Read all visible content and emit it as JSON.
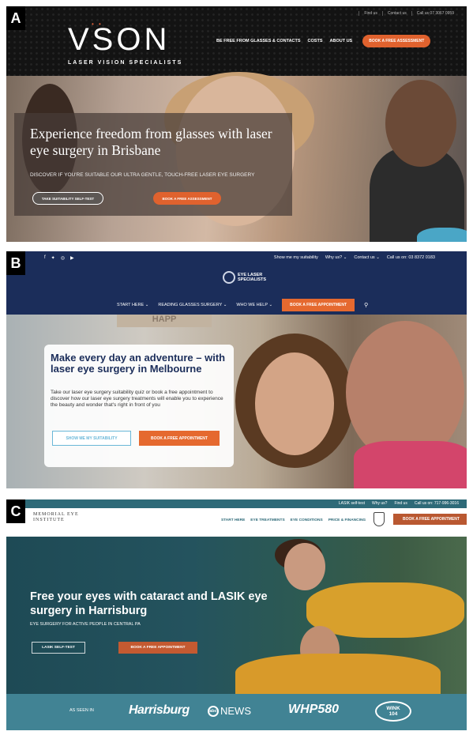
{
  "panel_a": {
    "letter": "A",
    "util_links": [
      "Find us",
      "Contact us",
      "Call us 07 3067 0959"
    ],
    "logo_word": "VSON",
    "logo_dots": "• •",
    "logo_sub": "LASER VISION SPECIALISTS",
    "nav": [
      "BE FREE FROM GLASSES & CONTACTS",
      "COSTS",
      "ABOUT US"
    ],
    "nav_cta": "BOOK A FREE ASSESSMENT",
    "headline": "Experience freedom from glasses with laser eye surgery in Brisbane",
    "subline": "DISCOVER IF YOU'RE SUITABLE OUR ULTRA GENTLE, TOUCH-FREE LASER EYE SURGERY",
    "button_primary": "TAKE SUITABILITY SELF-TEST",
    "button_secondary": "BOOK A FREE ASSESSMENT"
  },
  "panel_b": {
    "letter": "B",
    "social": [
      "f",
      "✦",
      "◎",
      "▶"
    ],
    "util_links": [
      "Show me my suitability",
      "Why us? ⌄",
      "Contact us ⌄",
      "Call us on: 03 8372 0183"
    ],
    "logo_line1": "EYE LASER",
    "logo_line2": "SPECIALISTS",
    "nav": [
      "START HERE ⌄",
      "READING GLASSES SURGERY ⌄",
      "WHO WE HELP ⌄"
    ],
    "nav_cta": "BOOK A FREE APPOINTMENT",
    "sign_text": "HAPP",
    "headline": "Make every day an adventure – with laser eye surgery in Melbourne",
    "body": "Take our laser eye surgery suitability quiz or book a free appointment to discover how our laser eye surgery treatments will enable you to experience the beauty and wonder that's right in front of you",
    "button_primary": "SHOW ME MY SUITABILITY",
    "button_secondary": "BOOK A FREE APPOINTMENT"
  },
  "panel_c": {
    "letter": "C",
    "util_links": [
      "LASIK self-test",
      "Why us?",
      "Find us",
      "Call us on: 717-996-3016"
    ],
    "logo_line1": "MEMORIAL EYE",
    "logo_line2": "INSTITUTE",
    "nav": [
      "START HERE",
      "EYE TREATMENTS",
      "EYE CONDITIONS",
      "PRICE & FINANCING"
    ],
    "nav_cta": "BOOK A FREE APPOINTMENT",
    "headline": "Free your eyes with cataract and LASIK eye surgery in Harrisburg",
    "subline": "EYE SURGERY FOR ACTIVE PEOPLE IN CENTRAL PA",
    "button_primary": "LASIK SELF-TEST",
    "button_secondary": "BOOK A FREE APPOINTMENT",
    "as_seen_in": "AS SEEN IN",
    "media": {
      "m1": "Harrisburg",
      "m2_abc": "abc",
      "m2_news": "NEWS",
      "m3": "WHP580",
      "m4_line1": "WINK",
      "m4_line2": "104"
    }
  },
  "colors": {
    "a_accent": "#e0622e",
    "b_navy": "#1b2d5a",
    "b_accent": "#e5692f",
    "c_teal": "#2e6a78",
    "c_accent": "#c45a31"
  }
}
